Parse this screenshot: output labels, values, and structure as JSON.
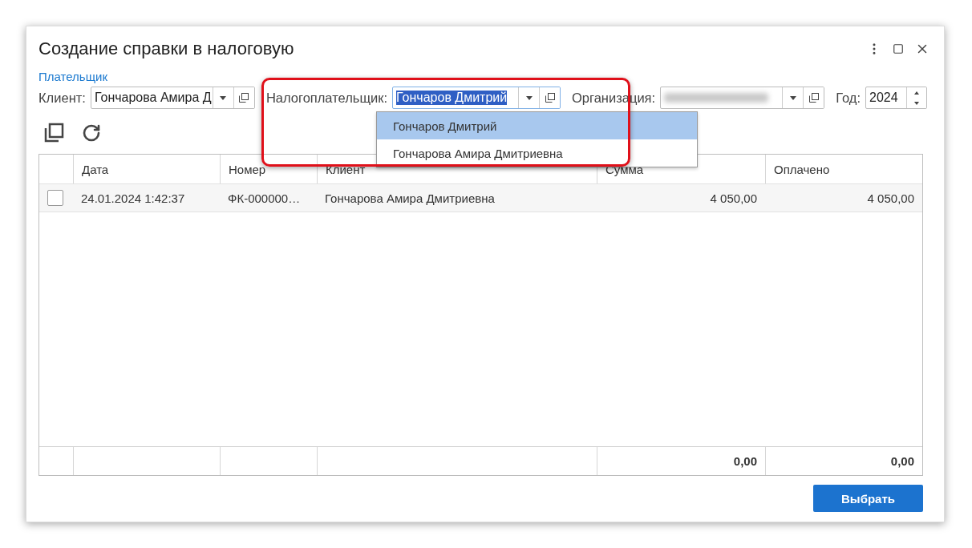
{
  "window": {
    "title": "Создание справки в налоговую"
  },
  "section_link": "Плательщик",
  "filters": [
    {
      "kind": "select",
      "label": "Клиент:",
      "value": "Гончарова Амира Д",
      "focused": false
    },
    {
      "kind": "select",
      "label": "Налогоплательщик:",
      "value": "Гончаров Дмитрий",
      "focused": true
    },
    {
      "kind": "select",
      "label": "Организация:",
      "blurred": true,
      "focused": false
    },
    {
      "kind": "number",
      "label": "Год:",
      "value": "2024"
    }
  ],
  "dropdown": {
    "items": [
      {
        "label": "Гончаров Дмитрий",
        "selected": true
      },
      {
        "label": "Гончарова Амира Дмитриевна",
        "selected": false
      }
    ]
  },
  "table": {
    "columns": [
      {
        "kind": "text",
        "label": "Дата"
      },
      {
        "kind": "text",
        "label": "Номер"
      },
      {
        "kind": "text",
        "label": "Клиент"
      },
      {
        "kind": "money",
        "label": "Сумма",
        "total": "0,00"
      },
      {
        "kind": "money",
        "label": "Оплачено",
        "total": "0,00"
      }
    ],
    "rows": [
      {
        "checked": false,
        "cells": [
          "24.01.2024 1:42:37",
          "ФК-000000…",
          "Гончарова Амира Дмитриевна",
          "4 050,00",
          "4 050,00"
        ]
      }
    ]
  },
  "buttons": [
    {
      "label": "Выбрать"
    }
  ]
}
